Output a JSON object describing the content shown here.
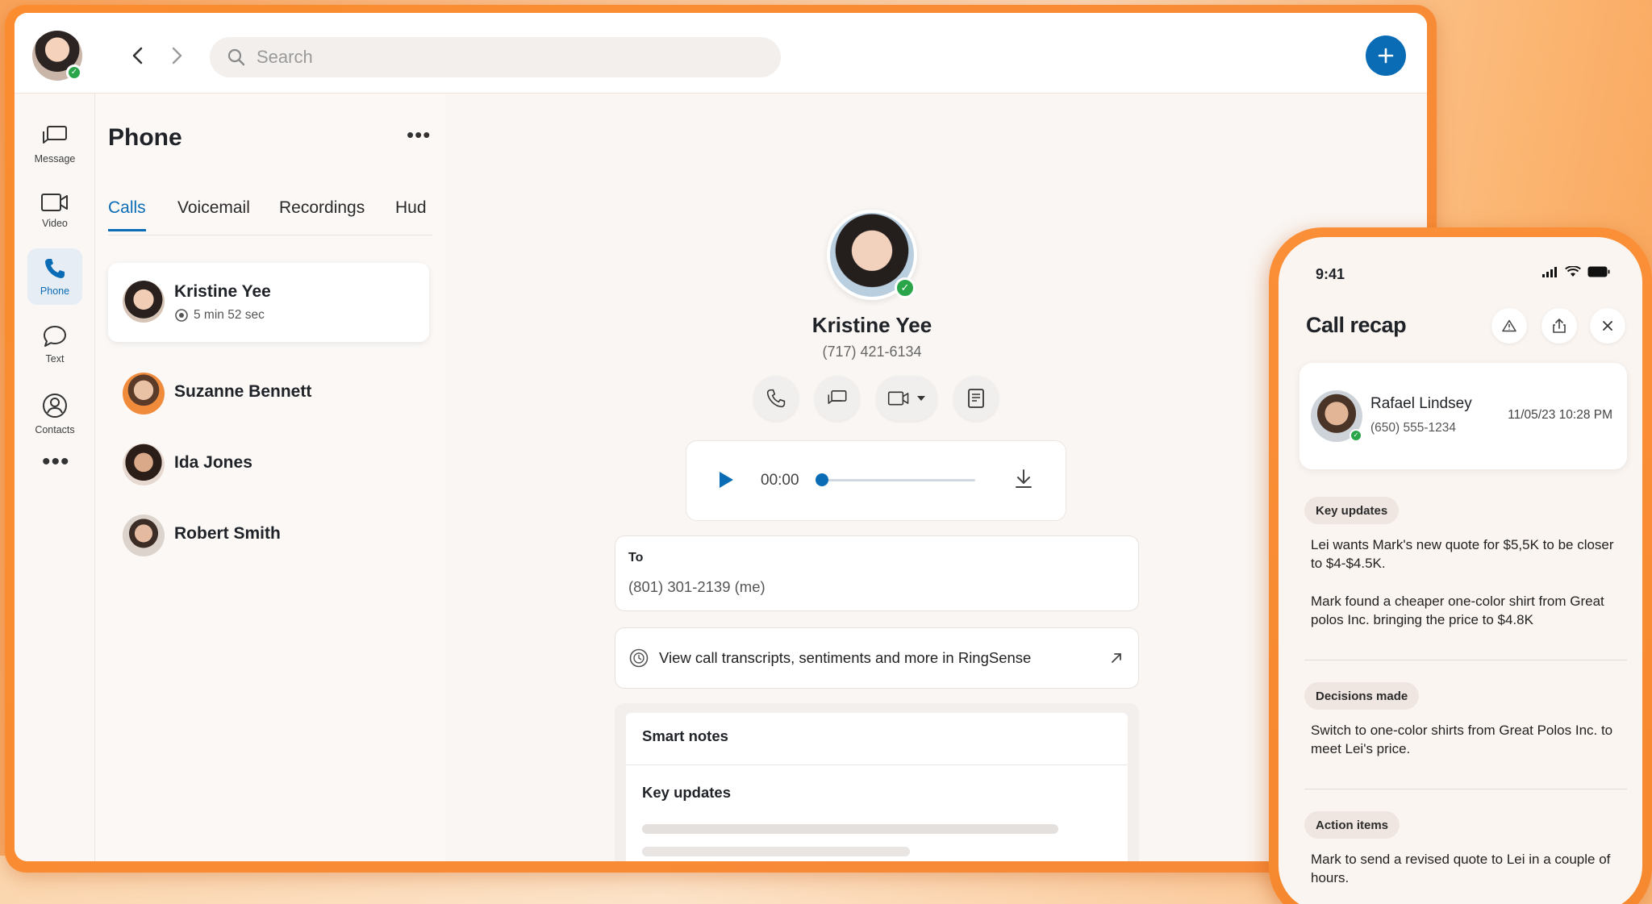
{
  "topbar": {
    "search_placeholder": "Search"
  },
  "rail": {
    "items": [
      {
        "label": "Message"
      },
      {
        "label": "Video"
      },
      {
        "label": "Phone"
      },
      {
        "label": "Text"
      },
      {
        "label": "Contacts"
      }
    ],
    "more": "•••"
  },
  "panel": {
    "title": "Phone",
    "more": "•••",
    "tabs": [
      {
        "label": "Calls"
      },
      {
        "label": "Voicemail"
      },
      {
        "label": "Recordings"
      },
      {
        "label": "Hud"
      }
    ],
    "contacts": [
      {
        "name": "Kristine Yee",
        "duration": "5 min 52 sec"
      },
      {
        "name": "Suzanne Bennett"
      },
      {
        "name": "Ida Jones"
      },
      {
        "name": "Robert Smith"
      }
    ]
  },
  "detail": {
    "name": "Kristine Yee",
    "phone": "(717) 421-6134",
    "player_time": "00:00",
    "player_progress": 0.0,
    "to_label": "To",
    "to_value": "(801) 301-2139 (me)",
    "ringsense_text": "View call transcripts, sentiments and more in RingSense",
    "smart_notes_title": "Smart notes",
    "key_updates_title": "Key updates"
  },
  "phone": {
    "time": "9:41",
    "title": "Call recap",
    "contact_name": "Rafael Lindsey",
    "contact_phone": "(650) 555-1234",
    "contact_datetime": "11/05/23 10:28 PM",
    "sections": [
      {
        "label": "Key updates",
        "texts": [
          "Lei wants Mark's new quote for $5,5K to be closer to $4-$4.5K.",
          "Mark found a cheaper one-color shirt from Great polos Inc. bringing the price to $4.8K"
        ]
      },
      {
        "label": "Decisions made",
        "texts": [
          "Switch to one-color shirts from Great Polos Inc. to meet Lei's price."
        ]
      },
      {
        "label": "Action items",
        "texts": [
          "Mark to send a revised quote to Lei in a couple of hours."
        ]
      }
    ]
  },
  "colors": {
    "accent": "#0b6cb6",
    "frame_orange": "#fb8c2f",
    "online_green": "#2aa54a"
  },
  "icons": [
    "chevron-left-icon",
    "chevron-right-icon",
    "search-icon",
    "plus-icon",
    "message-icon",
    "video-icon",
    "phone-icon",
    "text-icon",
    "contacts-icon",
    "record-icon",
    "call-icon",
    "chat-icon",
    "video-call-icon",
    "notes-icon",
    "play-icon",
    "download-icon",
    "ringsense-icon",
    "external-link-icon",
    "alert-icon",
    "share-icon",
    "close-icon",
    "signal-icon",
    "wifi-icon",
    "battery-icon"
  ]
}
